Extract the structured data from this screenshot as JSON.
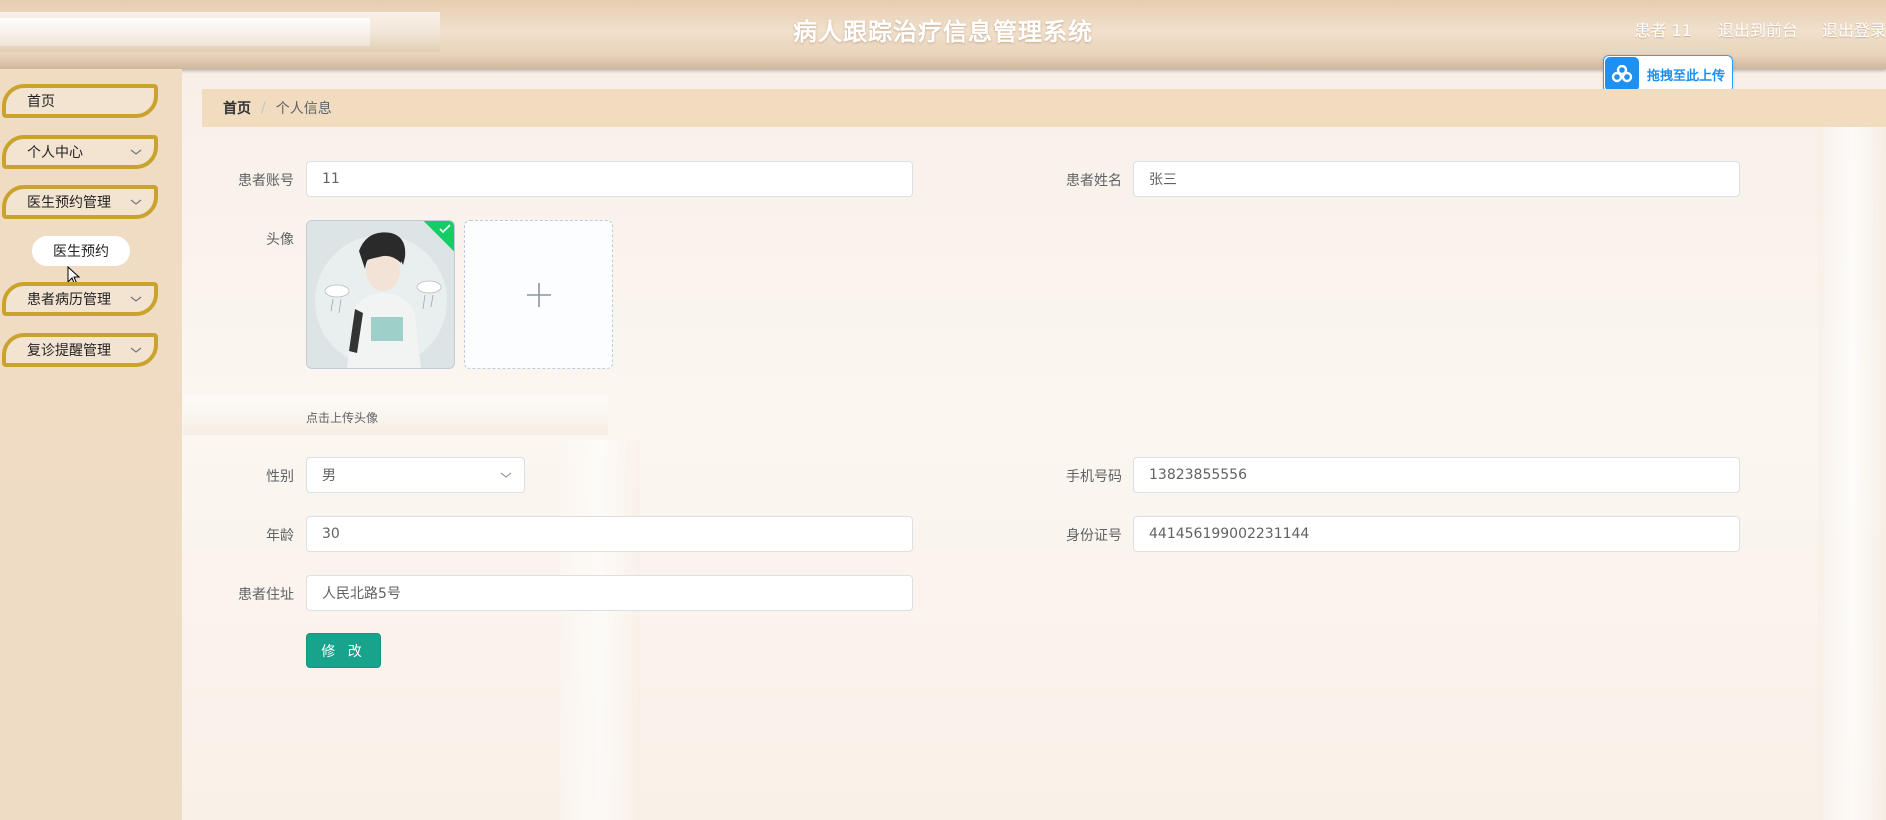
{
  "header": {
    "title": "病人跟踪治疗信息管理系统",
    "user_label": "患者 11",
    "front_link": "退出到前台",
    "logout_link": "退出登录"
  },
  "upload_badge": {
    "text": "拖拽至此上传",
    "icon": "cloud-icon",
    "color": "#1e90f2"
  },
  "sidebar": {
    "items": [
      {
        "label": "首页"
      },
      {
        "label": "个人中心",
        "icon": "chevron-down-icon"
      },
      {
        "label": "医生预约管理",
        "icon": "chevron-down-icon"
      },
      {
        "label": "患者病历管理",
        "icon": "chevron-down-icon"
      },
      {
        "label": "复诊提醒管理",
        "icon": "chevron-down-icon"
      }
    ],
    "submenu": {
      "label": "医生预约"
    },
    "accent": "#c9a32d"
  },
  "breadcrumb": {
    "home": "首页",
    "separator": "/",
    "current": "个人信息"
  },
  "form": {
    "account_label": "患者账号",
    "account_value": "11",
    "name_label": "患者姓名",
    "name_value": "张三",
    "avatar_label": "头像",
    "upload_tip": "点击上传头像",
    "gender_label": "性别",
    "gender_value": "男",
    "phone_label": "手机号码",
    "phone_value": "13823855556",
    "age_label": "年龄",
    "age_value": "30",
    "idcard_label": "身份证号",
    "idcard_value": "441456199002231144",
    "address_label": "患者住址",
    "address_value": "人民北路5号",
    "submit_label": "修 改",
    "submit_color": "#18a38c"
  }
}
